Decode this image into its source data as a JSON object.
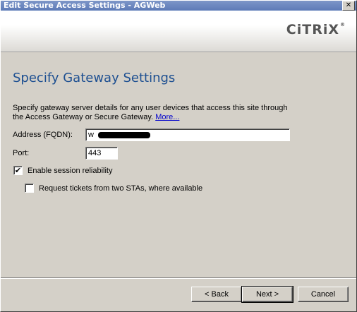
{
  "window": {
    "title": "Edit Secure Access Settings - AGWeb",
    "close_glyph": "✕"
  },
  "header": {
    "logo_text": "CiTRiX",
    "logo_mark": "®"
  },
  "main": {
    "title": "Specify Gateway Settings",
    "description": "Specify gateway server details for any user devices that access this site through the Access Gateway or Secure Gateway.",
    "more_link": "More...",
    "address_label": "Address (FQDN):",
    "address_value": "w",
    "port_label": "Port:",
    "port_value": "443",
    "session_reliability_label": "Enable session reliability",
    "session_reliability_checked": true,
    "request_tickets_label": "Request tickets from two STAs, where available",
    "request_tickets_checked": false,
    "check_glyph": "✔"
  },
  "footer": {
    "back_label": "< Back",
    "next_label": "Next >",
    "cancel_label": "Cancel"
  }
}
